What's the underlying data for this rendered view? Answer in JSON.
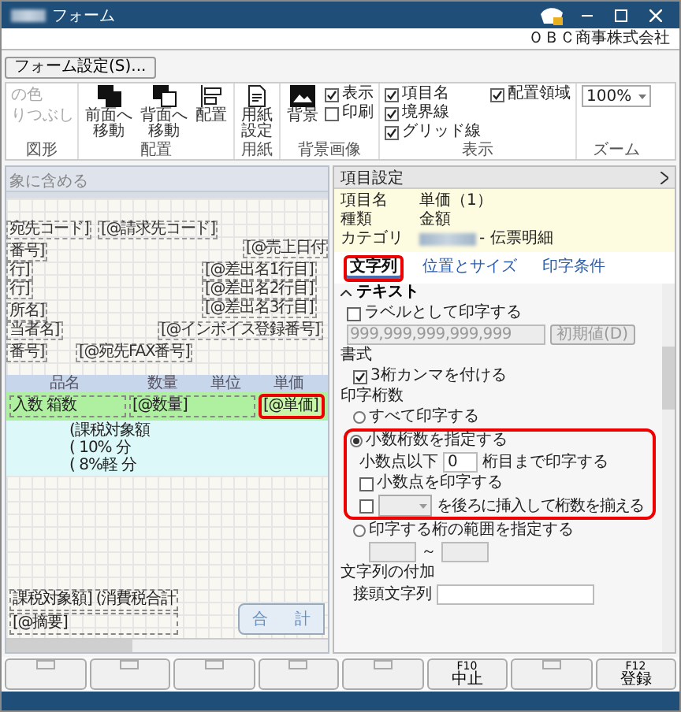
{
  "window": {
    "title": "フォーム",
    "company": "ＯＢＣ商事株式会社"
  },
  "toolbar": {
    "button": "フォーム設定(S)..."
  },
  "ribbon": {
    "shape": {
      "label": "図形",
      "items": [
        "の色",
        "りつぶし"
      ]
    },
    "arrange": {
      "label": "配置",
      "buttons": [
        "前面へ移動",
        "背面へ移動",
        "配置"
      ]
    },
    "paper": {
      "label": "用紙",
      "button": "用紙設定"
    },
    "background": {
      "label": "背景画像",
      "button": "背景",
      "checks": [
        {
          "label": "表示",
          "checked": true
        },
        {
          "label": "印刷",
          "checked": false
        }
      ]
    },
    "display": {
      "label": "表示",
      "checks": [
        {
          "label": "項目名",
          "checked": true
        },
        {
          "label": "境界線",
          "checked": true
        },
        {
          "label": "グリッド線",
          "checked": true
        },
        {
          "label": "配置領域",
          "checked": true
        }
      ]
    },
    "zoom": {
      "label": "ズーム",
      "value": "100%"
    }
  },
  "form": {
    "header": "象に含める",
    "fields": [
      "宛先コード]",
      "[@請求先コード]",
      "番号]",
      "行]",
      "行]",
      "所名]",
      "当者名]",
      "番号]",
      "[@宛先FAX番号]",
      "[@売上日付",
      "[@差出名1行目]",
      "[@差出名2行目]",
      "[@差出名3行目]",
      "[@インボイス登録番号]"
    ],
    "columns": [
      "品名",
      "数量",
      "単位",
      "単価"
    ],
    "detail_row": [
      {
        "text": "入数 箱数",
        "highlighted": false
      },
      {
        "text": "[@数量]",
        "highlighted": false
      },
      {
        "text": "[@単価]",
        "highlighted": true
      }
    ],
    "tax_rows": [
      "(課税対象額",
      "( 10% 分",
      "( 8%軽 分"
    ],
    "footer": [
      "課税対象額] (消費税合計",
      "[@摘要]"
    ],
    "total": "合 計"
  },
  "panel": {
    "title": "項目設定",
    "info": [
      {
        "label": "項目名",
        "value": "単価（1）"
      },
      {
        "label": "種類",
        "value": "金額"
      },
      {
        "label": "カテゴリ",
        "value": "- 伝票明細"
      }
    ],
    "tabs": [
      {
        "label": "文字列",
        "selected": true,
        "highlighted": true
      },
      {
        "label": "位置とサイズ",
        "selected": false,
        "highlighted": false
      },
      {
        "label": "印字条件",
        "selected": false,
        "highlighted": false
      }
    ],
    "section": "テキスト",
    "label_check": {
      "label": "ラベルとして印字する",
      "checked": false
    },
    "sample": {
      "placeholder": "999,999,999,999,999",
      "button": "初期値(D)",
      "disabled": true
    },
    "format_title": "書式",
    "comma_check": {
      "label": "3桁カンマを付ける",
      "checked": true
    },
    "digits_title": "印字桁数",
    "radio_all": {
      "label": "すべて印字する",
      "selected": false
    },
    "radio_decimal": {
      "label": "小数桁数を指定する",
      "selected": true,
      "highlighted": true
    },
    "decimal_prefix": "小数点以下",
    "decimal_value": "0",
    "decimal_suffix": "桁目まで印字する",
    "point_check": {
      "label": "小数点を印字する",
      "checked": false
    },
    "pad_check": {
      "label": "を後ろに挿入して桁数を揃える",
      "checked": false
    },
    "radio_range": {
      "label": "印字する桁の範囲を指定する",
      "selected": false
    },
    "range_sep": "～",
    "append_title": "文字列の付加",
    "prefix_label": "接頭文字列"
  },
  "function_keys": [
    {
      "kind": "blank"
    },
    {
      "kind": "blank"
    },
    {
      "kind": "blank"
    },
    {
      "kind": "blank"
    },
    {
      "kind": "blank"
    },
    {
      "kind": "labeled",
      "key": "F10",
      "label": "中止"
    },
    {
      "kind": "blank"
    },
    {
      "kind": "labeled",
      "key": "F12",
      "label": "登録"
    }
  ]
}
